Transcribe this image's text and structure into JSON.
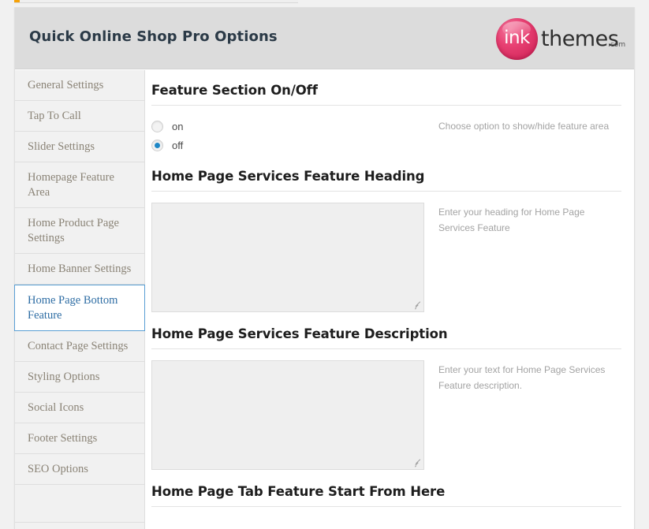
{
  "window": {
    "panel_title": "Quick Online Shop Pro Options"
  },
  "brand": {
    "mark_text": "ink",
    "name_text": "themes",
    "tld_text": ".com",
    "circle_color": "#e8376a",
    "word_color": "#2e2e2e"
  },
  "sidebar": {
    "items": [
      {
        "label": "General Settings",
        "active": false
      },
      {
        "label": "Tap To Call",
        "active": false
      },
      {
        "label": "Slider Settings",
        "active": false
      },
      {
        "label": "Homepage Feature Area",
        "active": false
      },
      {
        "label": "Home Product Page Settings",
        "active": false
      },
      {
        "label": "Home Banner Settings",
        "active": false
      },
      {
        "label": "Home Page Bottom Feature",
        "active": true
      },
      {
        "label": "Contact Page Settings",
        "active": false
      },
      {
        "label": "Styling Options",
        "active": false
      },
      {
        "label": "Social Icons",
        "active": false
      },
      {
        "label": "Footer Settings",
        "active": false
      },
      {
        "label": "SEO Options",
        "active": false
      }
    ],
    "active_color": "#2e6da4",
    "active_border_color": "#5a9fd4",
    "text_color": "#8a8376"
  },
  "sections": {
    "feature_toggle": {
      "title": "Feature Section On/Off",
      "options": [
        {
          "label": "on",
          "checked": false
        },
        {
          "label": "off",
          "checked": true
        }
      ],
      "hint": "Choose option to show/hide feature area",
      "checked_color": "#1e87c6"
    },
    "services_heading": {
      "title": "Home Page Services Feature Heading",
      "value": "",
      "placeholder": "",
      "hint": "Enter your heading for Home Page Services Feature"
    },
    "services_description": {
      "title": "Home Page Services Feature Description",
      "value": "",
      "placeholder": "",
      "hint": "Enter your text for Home Page Services Feature description."
    },
    "tab_feature": {
      "title": "Home Page Tab Feature Start From Here"
    }
  }
}
